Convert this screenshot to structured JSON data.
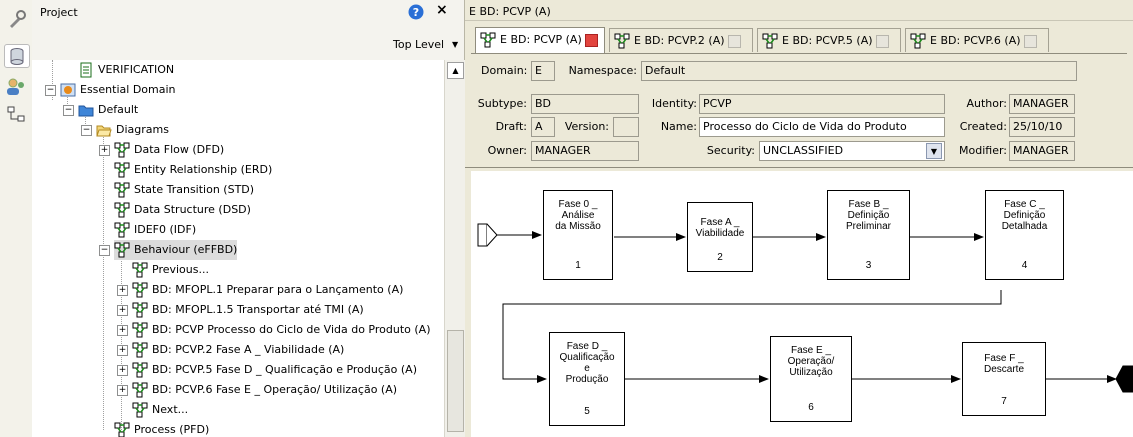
{
  "project_panel": {
    "title": "Project",
    "level": "Top Level",
    "tree": [
      {
        "label": "VERIFICATION",
        "icon": "document-icon"
      },
      {
        "label": "Essential Domain",
        "icon": "domain-icon"
      },
      {
        "label": "Default",
        "icon": "folder-icon"
      },
      {
        "label": "Diagrams",
        "icon": "open-folder-icon"
      },
      {
        "label": "Data Flow (DFD)",
        "icon": "diagram-icon"
      },
      {
        "label": "Entity Relationship (ERD)",
        "icon": "diagram-icon"
      },
      {
        "label": "State Transition (STD)",
        "icon": "diagram-icon"
      },
      {
        "label": "Data Structure (DSD)",
        "icon": "diagram-icon"
      },
      {
        "label": "IDEF0 (IDF)",
        "icon": "diagram-icon"
      },
      {
        "label": "Behaviour (eFFBD)",
        "icon": "diagram-icon"
      },
      {
        "label": "Previous...",
        "icon": "diagram-icon"
      },
      {
        "label": "BD: MFOPL.1 Preparar para o Lançamento (A)",
        "icon": "diagram-icon"
      },
      {
        "label": "BD: MFOPL.1.5 Transportar até TMI (A)",
        "icon": "diagram-icon"
      },
      {
        "label": "BD: PCVP Processo do Ciclo de Vida do Produto (A)",
        "icon": "diagram-icon"
      },
      {
        "label": "BD: PCVP.2 Fase A _ Viabilidade (A)",
        "icon": "diagram-icon"
      },
      {
        "label": "BD: PCVP.5 Fase D _ Qualificação e Produção (A)",
        "icon": "diagram-icon"
      },
      {
        "label": "BD: PCVP.6 Fase E _ Operação/ Utilização (A)",
        "icon": "diagram-icon"
      },
      {
        "label": "Next...",
        "icon": "diagram-icon"
      },
      {
        "label": "Process (PFD)",
        "icon": "diagram-icon"
      }
    ]
  },
  "editor": {
    "window_title": "E BD: PCVP (A)",
    "tabs": [
      {
        "label": "E BD: PCVP (A)",
        "active": true
      },
      {
        "label": "E BD: PCVP.2 (A)",
        "active": false
      },
      {
        "label": "E BD: PCVP.5 (A)",
        "active": false
      },
      {
        "label": "E BD: PCVP.6 (A)",
        "active": false
      }
    ],
    "props": {
      "domain_label": "Domain:",
      "domain": "E",
      "namespace_label": "Namespace:",
      "namespace": "Default",
      "subtype_label": "Subtype:",
      "subtype": "BD",
      "identity_label": "Identity:",
      "identity": "PCVP",
      "author_label": "Author:",
      "author": "MANAGER",
      "draft_label": "Draft:",
      "draft": "A",
      "version_label": "Version:",
      "version": "",
      "name_label": "Name:",
      "name": "Processo do Ciclo de Vida do Produto",
      "created_label": "Created:",
      "created": "25/10/10",
      "owner_label": "Owner:",
      "owner": "MANAGER",
      "security_label": "Security:",
      "security": "UNCLASSIFIED",
      "modifier_label": "Modifier:",
      "modifier": "MANAGER"
    }
  },
  "diagram": {
    "functions": [
      {
        "title": "Fase 0 _\nAnálise\nda Missão",
        "num": "1"
      },
      {
        "title": "Fase A _\nViabilidade",
        "num": "2"
      },
      {
        "title": "Fase B _\nDefinição\nPreliminar",
        "num": "3"
      },
      {
        "title": "Fase C _\nDefinição\nDetalhada",
        "num": "4"
      },
      {
        "title": "Fase D _\nQualificação\ne\nProdução",
        "num": "5"
      },
      {
        "title": "Fase E _\nOperação/\nUtilização",
        "num": "6"
      },
      {
        "title": "Fase F _\nDescarte",
        "num": "7"
      }
    ]
  },
  "colors": {
    "accent_tab_close": "#e2443e",
    "panel_bg": "#ece9d8",
    "help_blue": "#2a6fd6"
  }
}
